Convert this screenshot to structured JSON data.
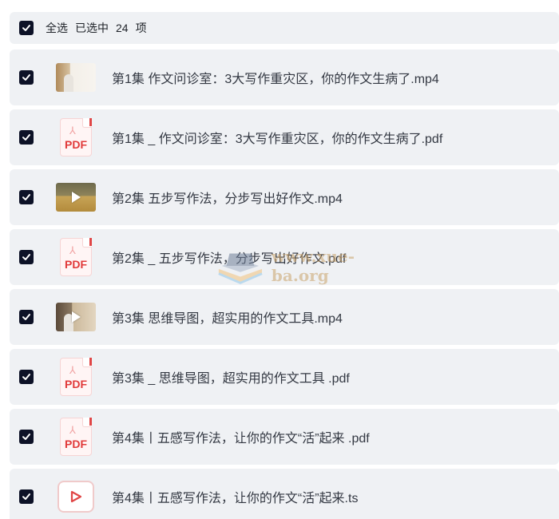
{
  "selection_bar": {
    "select_all_label": "全选",
    "selected_prefix": "已选中",
    "selected_count": "24",
    "selected_suffix": "项"
  },
  "files": [
    {
      "name": "第1集  作文问诊室：3大写作重灾区，你的作文生病了.mp4",
      "type": "video",
      "checked": true
    },
    {
      "name": "第1集 _ 作文问诊室：3大写作重灾区，你的作文生病了.pdf",
      "type": "pdf",
      "checked": true
    },
    {
      "name": "第2集  五步写作法，分步写出好作文.mp4",
      "type": "video",
      "checked": true
    },
    {
      "name": "第2集 _ 五步写作法，分步写出好作文.pdf",
      "type": "pdf",
      "checked": true
    },
    {
      "name": "第3集  思维导图，超实用的作文工具.mp4",
      "type": "video",
      "checked": true
    },
    {
      "name": "第3集 _ 思维导图，超实用的作文工具 .pdf",
      "type": "pdf",
      "checked": true
    },
    {
      "name": "第4集丨五感写作法，让你的作文“活”起来 .pdf",
      "type": "pdf",
      "checked": true
    },
    {
      "name": "第4集丨五感写作法，让你的作文“活”起来.ts",
      "type": "ts",
      "checked": true
    }
  ],
  "pdf_icon_label": "PDF",
  "watermark": {
    "text": "www.xue-ba.org"
  },
  "colors": {
    "checkbox": "#0d1227",
    "row_background": "#eff1f4",
    "pdf_red": "#e13a3a",
    "watermark": "#c9a36b"
  }
}
